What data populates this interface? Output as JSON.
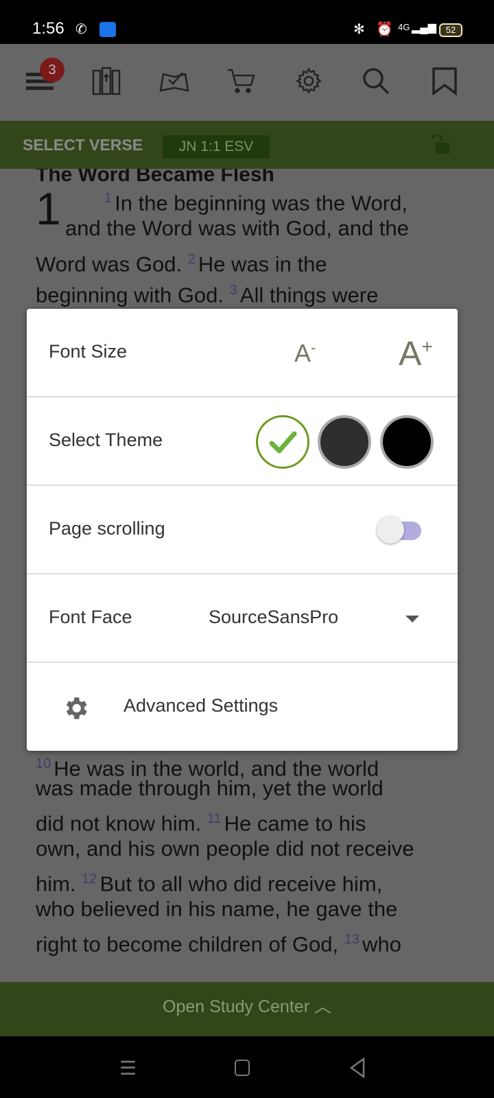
{
  "status_bar": {
    "time": "1:56",
    "battery": "52",
    "network": "4G"
  },
  "toolbar": {
    "menu_badge": "3",
    "icons": [
      "menu-icon",
      "library-icon",
      "reading-plan-icon",
      "cart-icon",
      "gear-icon",
      "search-icon",
      "bookmark-icon"
    ]
  },
  "verse_bar": {
    "label": "SELECT VERSE",
    "reference": "JN 1:1 ESV"
  },
  "bible": {
    "heading": "The Word Became Flesh",
    "chapter": "1",
    "lines": [
      {
        "vn": "1",
        "text": "In the beginning was the Word,"
      },
      {
        "vn": "",
        "text": "and the Word was with God, and the"
      },
      {
        "vn": "",
        "text": "Word was God. ",
        "vn2": "2",
        "text2": "He was in the"
      },
      {
        "vn": "",
        "text": "beginning with God. ",
        "vn2": "3",
        "text2": "All things were"
      },
      {
        "vn": "10",
        "text": "He was in the world, and the world"
      },
      {
        "vn": "",
        "text": "was made through him, yet the world"
      },
      {
        "vn": "",
        "text": "did not know him. ",
        "vn2": "11",
        "text2": "He came to his"
      },
      {
        "vn": "",
        "text": "own, and his own people did not receive"
      },
      {
        "vn": "",
        "text": "him. ",
        "vn2": "12",
        "text2": "But to all who did receive him,"
      },
      {
        "vn": "",
        "text": "who believed in his name, he gave the"
      },
      {
        "vn": "",
        "text": "right to become children of God, ",
        "vn2": "13",
        "text2": "who"
      }
    ]
  },
  "settings": {
    "font_size_label": "Font Size",
    "decrease_label": "A",
    "decrease_sup": "-",
    "increase_label": "A",
    "increase_sup": "+",
    "theme_label": "Select Theme",
    "themes": [
      {
        "name": "light",
        "color": "#ffffff",
        "selected": true
      },
      {
        "name": "dark",
        "color": "#2e2e2e",
        "selected": false
      },
      {
        "name": "black",
        "color": "#000000",
        "selected": false
      }
    ],
    "accent": "#6a9a1e",
    "page_scrolling_label": "Page scrolling",
    "page_scrolling_on": false,
    "font_face_label": "Font Face",
    "font_face_value": "SourceSansPro",
    "advanced_label": "Advanced Settings"
  },
  "bottom_bar": {
    "label": "Open Study Center"
  }
}
